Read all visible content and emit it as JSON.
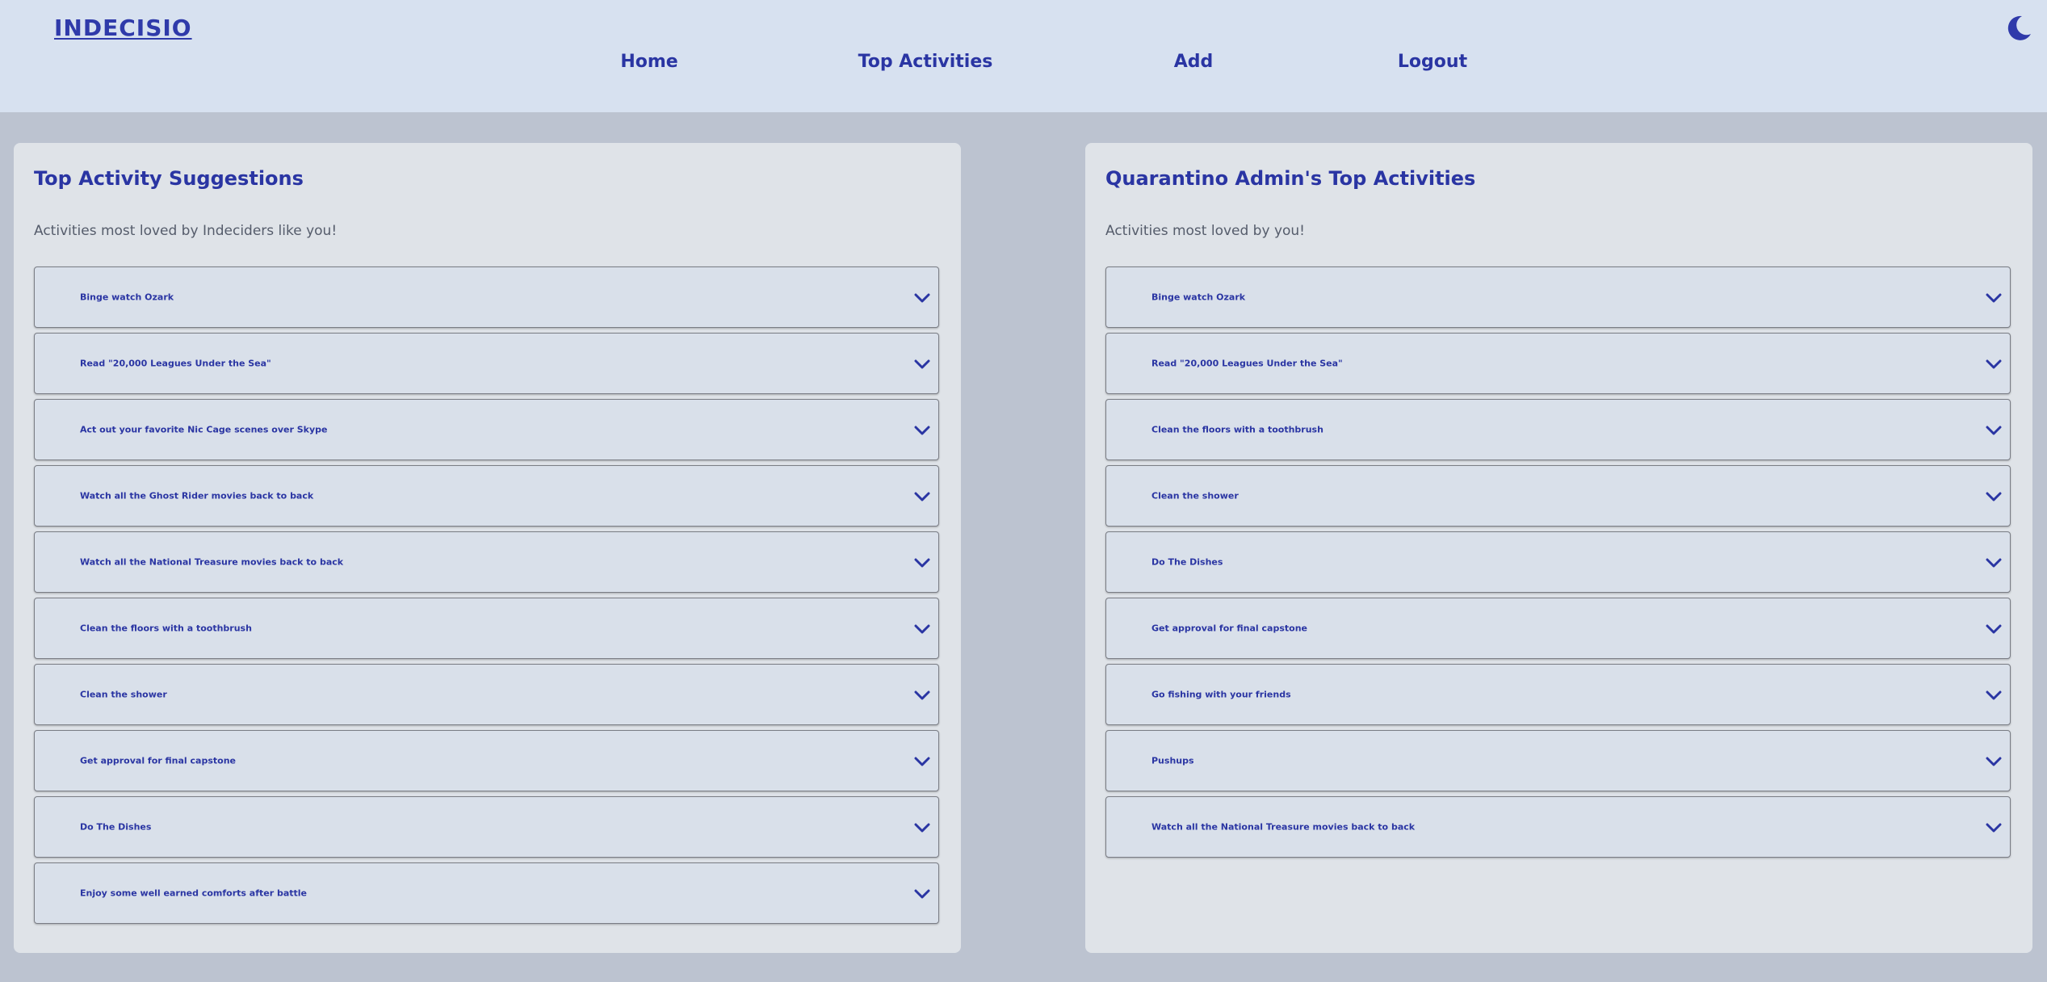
{
  "app": {
    "logo": "INDECISIO"
  },
  "nav": {
    "home": "Home",
    "top_activities": "Top Activities",
    "add": "Add",
    "logout": "Logout"
  },
  "icons": {
    "theme_toggle": "moon-icon",
    "expand": "chevron-down-icon"
  },
  "colors": {
    "accent": "#2a35a3",
    "header_bg": "#d7e1f0",
    "page_bg": "#bcc3d0",
    "panel_bg": "#dfe3e8"
  },
  "panels": {
    "suggestions": {
      "title": "Top Activity Suggestions",
      "subtitle": "Activities most loved by Indeciders like you!",
      "items": [
        "Binge watch Ozark",
        "Read \"20,000 Leagues Under the Sea\"",
        "Act out your favorite Nic Cage scenes over Skype",
        "Watch all the Ghost Rider movies back to back",
        "Watch all the National Treasure movies back to back",
        "Clean the floors with a toothbrush",
        "Clean the shower",
        "Get approval for final capstone",
        "Do The Dishes",
        "Enjoy some well earned comforts after battle"
      ]
    },
    "user": {
      "title": "Quarantino Admin's Top Activities",
      "subtitle": "Activities most loved by you!",
      "items": [
        "Binge watch Ozark",
        "Read \"20,000 Leagues Under the Sea\"",
        "Clean the floors with a toothbrush",
        "Clean the shower",
        "Do The Dishes",
        "Get approval for final capstone",
        "Go fishing with your friends",
        "Pushups",
        "Watch all the National Treasure movies back to back"
      ]
    }
  }
}
